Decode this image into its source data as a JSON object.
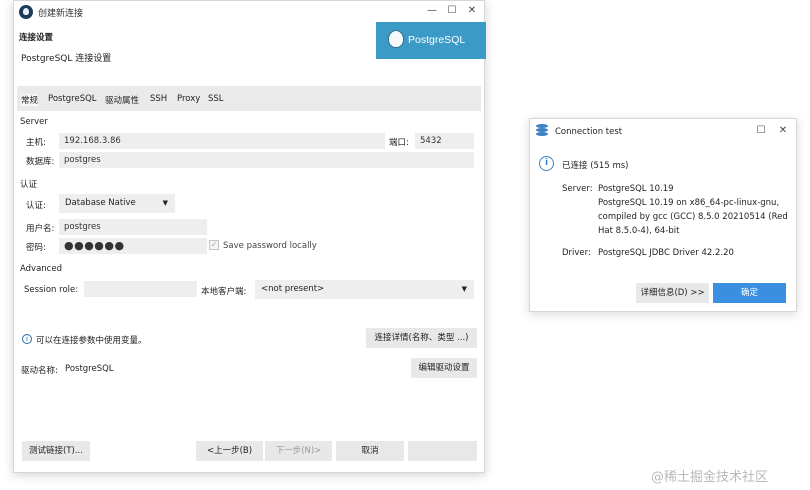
{
  "main_window": {
    "title": "创建新连接",
    "controls": {
      "minimize": "—",
      "maximize": "☐",
      "close": "✕"
    },
    "section_title": "连接设置",
    "section_subtitle": "PostgreSQL 连接设置",
    "banner_text": "PostgreSQL",
    "tabs": [
      {
        "label": "常规",
        "active": true
      },
      {
        "label": "PostgreSQL"
      },
      {
        "label": "驱动属性"
      },
      {
        "label": "SSH"
      },
      {
        "label": "Proxy"
      },
      {
        "label": "SSL"
      }
    ],
    "server": {
      "group_label": "Server",
      "host_label": "主机:",
      "host_value": "192.168.3.86",
      "port_label": "端口:",
      "port_value": "5432",
      "database_label": "数据库:",
      "database_value": "postgres"
    },
    "auth": {
      "group_label": "认证",
      "auth_label": "认证:",
      "auth_value": "Database Native",
      "username_label": "用户名:",
      "username_value": "postgres",
      "password_label": "密码:",
      "password_value": "●●●●●●",
      "save_password_label": "Save password locally",
      "save_password_checked": true
    },
    "advanced": {
      "group_label": "Advanced",
      "session_role_label": "Session role:",
      "session_role_value": "",
      "local_client_label": "本地客户端:",
      "local_client_value": "<not present>"
    },
    "variables_hint": "可以在连接参数中使用变量。",
    "connection_details_button": "连接详情(名称、类型 ...)",
    "driver_label": "驱动名称:",
    "driver_value": "PostgreSQL",
    "edit_driver_button": "编辑驱动设置",
    "footer": {
      "test_button": "测试链接(T)...",
      "prev_button": "<上一步(B)",
      "next_button": "下一步(N)>",
      "cancel_button": "取消",
      "finish_button": ""
    }
  },
  "dialog": {
    "title": "Connection test",
    "controls": {
      "maximize": "☐",
      "close": "✕"
    },
    "status": "已连接 (515 ms)",
    "server_label": "Server:",
    "server_lines": [
      "PostgreSQL 10.19",
      "PostgreSQL 10.19 on x86_64-pc-linux-gnu,",
      "compiled by gcc (GCC) 8.5.0 20210514 (Red",
      "Hat 8.5.0-4), 64-bit"
    ],
    "driver_label": "Driver:",
    "driver_value": "PostgreSQL JDBC Driver 42.2.20",
    "details_button": "详细信息(D) >>",
    "ok_button": "确定",
    "accent_color": "#3b8fe0"
  },
  "watermark": "@稀土掘金技术社区"
}
